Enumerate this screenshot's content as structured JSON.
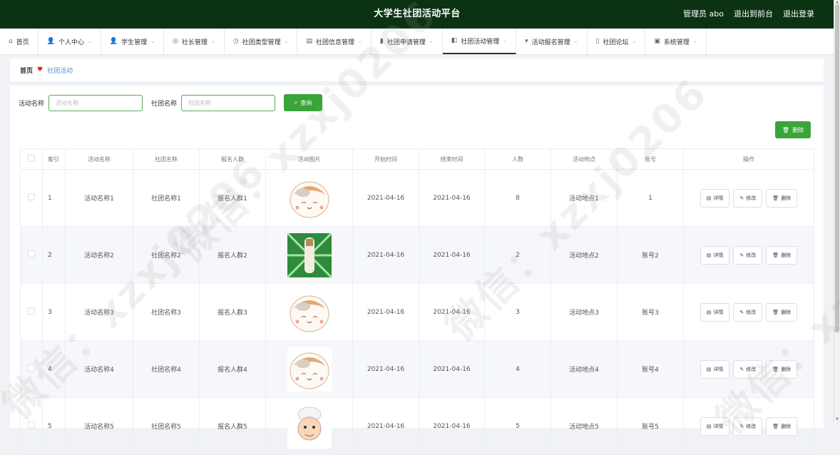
{
  "header": {
    "title": "大学生社团活动平台",
    "user": "管理员 abo",
    "back_to_front": "退出到前台",
    "logout": "退出登录"
  },
  "menu": [
    {
      "icon": "home-icon",
      "glyph": "⌂",
      "label": "首页",
      "chevron": false
    },
    {
      "icon": "user-icon",
      "glyph": "👤",
      "label": "个人中心",
      "chevron": true
    },
    {
      "icon": "student-icon",
      "glyph": "👤",
      "label": "学生管理",
      "chevron": true
    },
    {
      "icon": "leader-icon",
      "glyph": "◎",
      "label": "社长管理",
      "chevron": true
    },
    {
      "icon": "type-icon",
      "glyph": "◷",
      "label": "社团类型管理",
      "chevron": true
    },
    {
      "icon": "info-icon",
      "glyph": "▤",
      "label": "社团信息管理",
      "chevron": true
    },
    {
      "icon": "apply-icon",
      "glyph": "▮",
      "label": "社团申请管理",
      "chevron": true
    },
    {
      "icon": "activity-icon",
      "glyph": "◧",
      "label": "社团活动管理",
      "chevron": true,
      "active": true
    },
    {
      "icon": "signup-icon",
      "glyph": "▾",
      "label": "活动报名管理",
      "chevron": true
    },
    {
      "icon": "forum-icon",
      "glyph": "▯",
      "label": "社团论坛",
      "chevron": true
    },
    {
      "icon": "system-icon",
      "glyph": "▣",
      "label": "系统管理",
      "chevron": true
    }
  ],
  "breadcrumb": {
    "home": "首页",
    "current": "社团活动"
  },
  "search": {
    "label_activity": "活动名称",
    "placeholder_activity": "活动名称",
    "label_club": "社团名称",
    "placeholder_club": "社团名称",
    "query_label": "查询"
  },
  "top_delete_label": "删除",
  "table": {
    "headers": [
      "",
      "索引",
      "活动名称",
      "社团名称",
      "报名人群",
      "活动图片",
      "开始时间",
      "结束时间",
      "人数",
      "活动地点",
      "账号",
      "操作"
    ],
    "rows": [
      {
        "index": "1",
        "activity": "活动名称1",
        "club": "社团名称1",
        "crowd": "报名人群1",
        "image": "cat",
        "start": "2021-04-16",
        "end": "2021-04-16",
        "count": "8",
        "location": "活动地点1",
        "account": "1"
      },
      {
        "index": "2",
        "activity": "活动名称2",
        "club": "社团名称2",
        "crowd": "报名人群2",
        "image": "green",
        "start": "2021-04-16",
        "end": "2021-04-16",
        "count": "2",
        "location": "活动地点2",
        "account": "账号2"
      },
      {
        "index": "3",
        "activity": "活动名称3",
        "club": "社团名称3",
        "crowd": "报名人群3",
        "image": "cat",
        "start": "2021-04-16",
        "end": "2021-04-16",
        "count": "3",
        "location": "活动地点3",
        "account": "账号3"
      },
      {
        "index": "4",
        "activity": "活动名称4",
        "club": "社团名称4",
        "crowd": "报名人群4",
        "image": "cat",
        "start": "2021-04-16",
        "end": "2021-04-16",
        "count": "4",
        "location": "活动地点4",
        "account": "账号4"
      },
      {
        "index": "5",
        "activity": "活动名称5",
        "club": "社团名称5",
        "crowd": "报名人群5",
        "image": "chef",
        "start": "2021-04-16",
        "end": "2021-04-16",
        "count": "5",
        "location": "活动地点5",
        "account": "账号5"
      }
    ],
    "actions": {
      "detail": "详情",
      "edit": "修改",
      "delete": "删除"
    }
  },
  "watermark": "微信：xzxj0206",
  "colors": {
    "header_bg": "#0b3212",
    "accent_green": "#3aa43a",
    "breadcrumb_link": "#4a90e2",
    "heart": "#e02020"
  }
}
